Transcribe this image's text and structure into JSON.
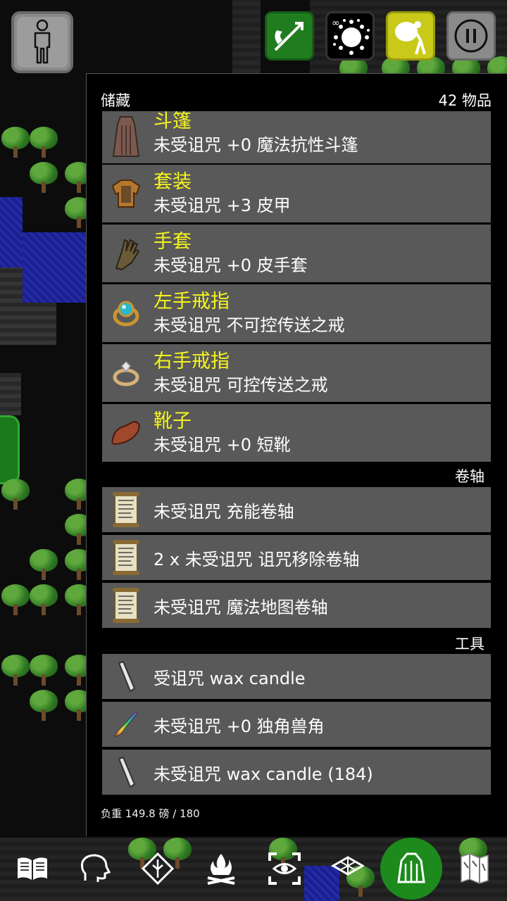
{
  "panel": {
    "title": "储藏",
    "count": "42 物品"
  },
  "worn": [
    {
      "slot": "斗篷",
      "desc": "未受诅咒 +0 魔法抗性斗篷",
      "icon": "cloak-icon"
    },
    {
      "slot": "套装",
      "desc": "未受诅咒 +3 皮甲",
      "icon": "leather-armor-icon"
    },
    {
      "slot": "手套",
      "desc": "未受诅咒 +0 皮手套",
      "icon": "gloves-icon"
    },
    {
      "slot": "左手戒指",
      "desc": "未受诅咒 不可控传送之戒",
      "icon": "sapphire-ring-icon"
    },
    {
      "slot": "右手戒指",
      "desc": "未受诅咒 可控传送之戒",
      "icon": "diamond-ring-icon"
    },
    {
      "slot": "靴子",
      "desc": "未受诅咒 +0 短靴",
      "icon": "boot-icon"
    }
  ],
  "categories": {
    "scrolls": "卷轴",
    "tools": "工具"
  },
  "scrolls": [
    {
      "label": "未受诅咒 充能卷轴",
      "icon": "scroll-icon"
    },
    {
      "label": "2 x 未受诅咒 诅咒移除卷轴",
      "icon": "scroll-icon"
    },
    {
      "label": "未受诅咒 魔法地图卷轴",
      "icon": "scroll-icon"
    }
  ],
  "tools": [
    {
      "label": "受诅咒 wax candle",
      "icon": "candle-icon"
    },
    {
      "label": "未受诅咒 +0 独角兽角",
      "icon": "unicorn-horn-icon"
    },
    {
      "label": "未受诅咒 wax candle (184)",
      "icon": "candle-icon"
    }
  ],
  "footer": {
    "weight": "负重 149.8 磅 / 180"
  },
  "top_buttons": [
    "character-icon",
    "fire-arrow-icon",
    "magic-burst-icon",
    "loot-bag-icon",
    "pause-icon"
  ],
  "bottom_buttons": [
    "spellbook-icon",
    "talk-icon",
    "pray-icon",
    "campfire-icon",
    "search-icon",
    "travel-icon",
    "inventory-icon",
    "map-icon"
  ],
  "colors": {
    "item_bg": "#595959",
    "slot_title": "#f5f51e",
    "active_green": "#1c8a1c"
  }
}
